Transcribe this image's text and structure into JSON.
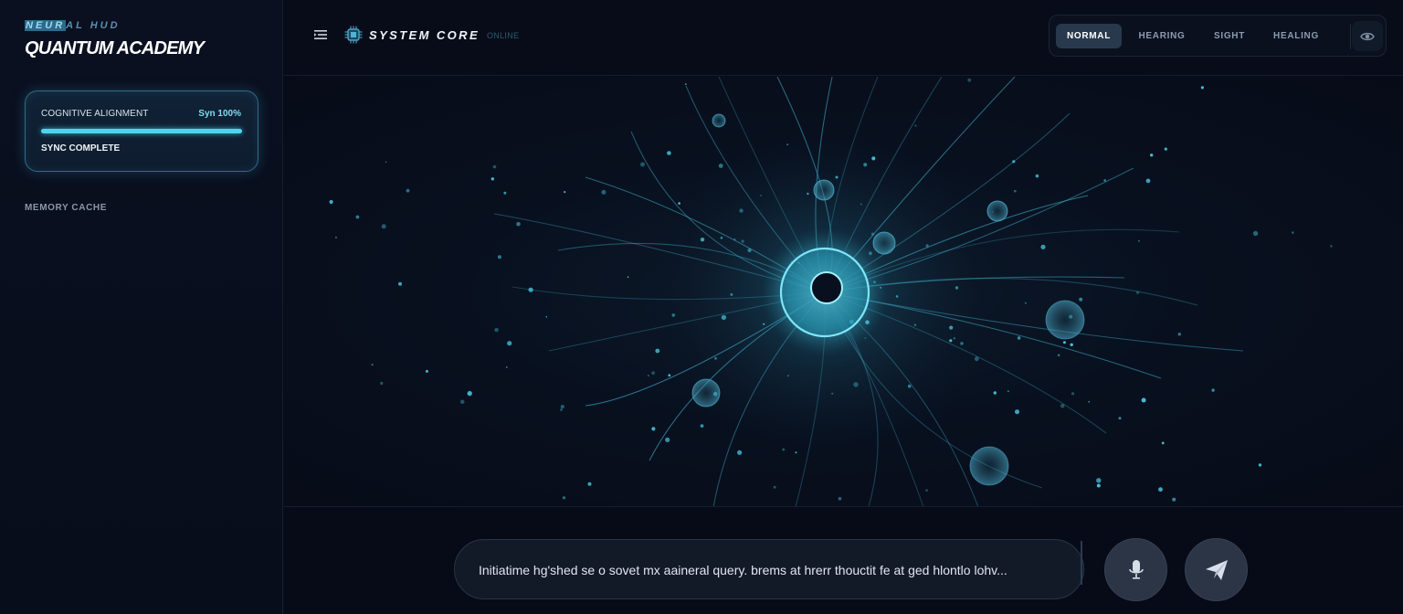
{
  "sidebar": {
    "brand_subtitle_highlight": "NEUR",
    "brand_subtitle_rest": "AL HUD",
    "brand_title": "QUANTUM ACADEMY",
    "sync": {
      "label": "COGNITIVE ALIGNMENT",
      "value_text": "Syn 100%",
      "progress": 1.0,
      "status": "SYNC COMPLETE"
    },
    "memory_label": "MEMORY CACHE"
  },
  "header": {
    "menu_icon": "menu-icon",
    "chip_icon": "cpu-chip-icon",
    "title": "SYSTEM CORE",
    "status": "ONLINE",
    "modes": [
      {
        "label": "NORMAL",
        "active": true
      },
      {
        "label": "HEARING",
        "active": false
      },
      {
        "label": "SIGHT",
        "active": false
      },
      {
        "label": "HEALING",
        "active": false
      }
    ],
    "eye_icon": "eye-icon"
  },
  "visualization": {
    "description_icon": "neural-network-core",
    "accent_color": "#4fd4ee"
  },
  "composer": {
    "input_value": "Initiatime hg'shed se o sovet mx aaineral query. brems at hrerr thouctit fe at ged hlontlo lohv...",
    "mic_icon": "microphone-icon",
    "send_icon": "send-icon"
  },
  "colors": {
    "background": "#070b17",
    "accent": "#4fd4ee",
    "panel": "#0a1020"
  }
}
